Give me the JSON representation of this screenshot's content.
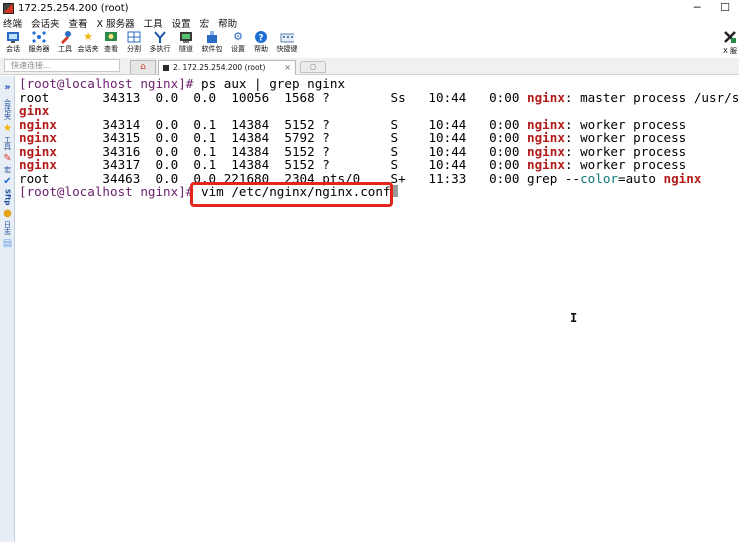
{
  "window": {
    "title": "172.25.254.200 (root)",
    "controls": [
      "─",
      "☐"
    ]
  },
  "menubar": [
    "终端",
    "会话夹",
    "查看",
    "X 服务器",
    "工具",
    "设置",
    "宏",
    "帮助"
  ],
  "toolbar": [
    {
      "label": "会话",
      "icon": "session-icon"
    },
    {
      "label": "服务器",
      "icon": "servers-icon"
    },
    {
      "label": "工具",
      "icon": "tools-icon"
    },
    {
      "label": "会话夹",
      "icon": "favorites-star-icon"
    },
    {
      "label": "查看",
      "icon": "view-icon"
    },
    {
      "label": "分割",
      "icon": "split-icon"
    },
    {
      "label": "多执行",
      "icon": "multiexec-icon"
    },
    {
      "label": "隧道",
      "icon": "tunnel-icon"
    },
    {
      "label": "软件包",
      "icon": "packages-icon"
    },
    {
      "label": "设置",
      "icon": "settings-gear-icon"
    },
    {
      "label": "帮助",
      "icon": "help-icon"
    },
    {
      "label": "快捷键",
      "icon": "shortcuts-icon"
    }
  ],
  "toolbar_right": {
    "label": "X 服",
    "icon": "xserver-icon"
  },
  "tabs": {
    "address_placeholder": "快速连接...",
    "session_tab": "2. 172.25.254.200 (root)",
    "session_close": "×"
  },
  "sidebar": [
    {
      "label": "会话夹",
      "icon": "star-icon"
    },
    {
      "label": "工具",
      "icon": "tools-icon"
    },
    {
      "label": "宏",
      "icon": "macro-icon"
    },
    {
      "label": "Sftp",
      "icon": "sftp-icon"
    },
    {
      "label": "日志",
      "icon": "log-icon"
    }
  ],
  "terminal": {
    "prompt1": "[root@localhost nginx]# ",
    "command1": "ps aux | grep nginx",
    "rows": [
      {
        "pre": "root       34313  0.0  0.0  10056  1568 ?        Ss   10:44   0:00 ",
        "hl": "nginx",
        "post": ": master process /usr/sbin/n"
      },
      {
        "pre": "",
        "hl": "ginx",
        "post": ""
      },
      {
        "pre": "",
        "hl": "nginx",
        "post": "      34314  0.0  0.1  14384  5152 ?        S    10:44   0:00 ",
        "hl2": "nginx",
        "post2": ": worker process"
      },
      {
        "pre": "",
        "hl": "nginx",
        "post": "      34315  0.0  0.1  14384  5792 ?        S    10:44   0:00 ",
        "hl2": "nginx",
        "post2": ": worker process"
      },
      {
        "pre": "",
        "hl": "nginx",
        "post": "      34316  0.0  0.1  14384  5152 ?        S    10:44   0:00 ",
        "hl2": "nginx",
        "post2": ": worker process"
      },
      {
        "pre": "",
        "hl": "nginx",
        "post": "      34317  0.0  0.1  14384  5152 ?        S    10:44   0:00 ",
        "hl2": "nginx",
        "post2": ": worker process"
      }
    ],
    "grep_row": {
      "pre": "root       34463  0.0  0.0 221680  2304 pts/0    S+   11:33   0:00 grep --",
      "color_kw": "color",
      "mid": "=auto ",
      "hl": "nginx"
    },
    "prompt2": "[root@localhost nginx]# ",
    "command2": "vim /etc/nginx/nginx.conf"
  }
}
